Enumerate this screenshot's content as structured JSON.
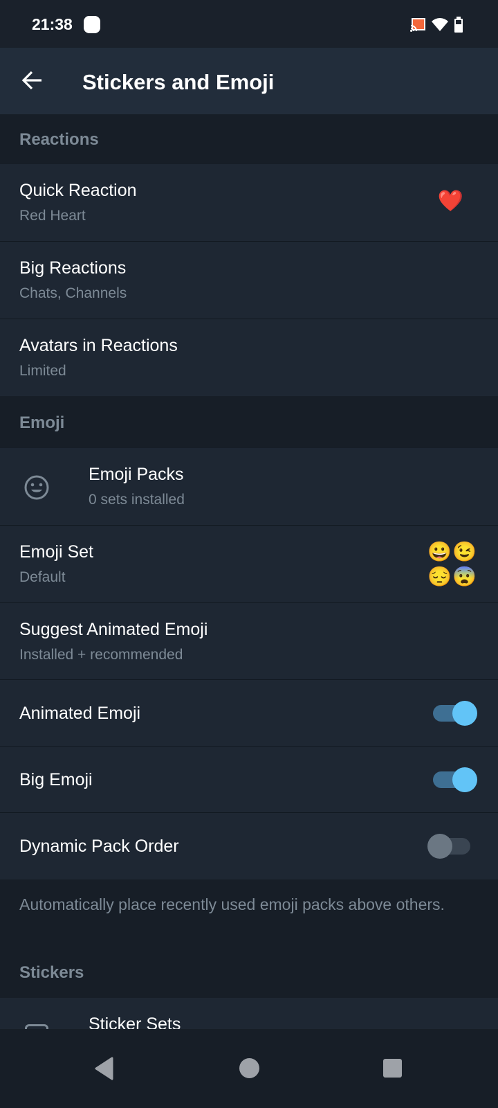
{
  "status_bar": {
    "time": "21:38"
  },
  "header": {
    "title": "Stickers and Emoji"
  },
  "sections": {
    "reactions": "Reactions",
    "emoji": "Emoji",
    "stickers": "Stickers"
  },
  "reactions": {
    "quick": {
      "title": "Quick Reaction",
      "subtitle": "Red Heart",
      "emoji": "❤️"
    },
    "big": {
      "title": "Big Reactions",
      "subtitle": "Chats, Channels"
    },
    "avatars": {
      "title": "Avatars in Reactions",
      "subtitle": "Limited"
    }
  },
  "emoji": {
    "packs": {
      "title": "Emoji Packs",
      "subtitle": "0 sets installed"
    },
    "set": {
      "title": "Emoji Set",
      "subtitle": "Default",
      "preview": [
        "😀",
        "😉",
        "😔",
        "😨"
      ]
    },
    "suggest": {
      "title": "Suggest Animated Emoji",
      "subtitle": "Installed + recommended"
    },
    "animated": {
      "title": "Animated Emoji",
      "on": true
    },
    "big": {
      "title": "Big Emoji",
      "on": true
    },
    "dynamic": {
      "title": "Dynamic Pack Order",
      "on": false
    },
    "info": "Automatically place recently used emoji packs above others."
  },
  "stickers": {
    "sets": {
      "title": "Sticker Sets"
    }
  },
  "colors": {
    "accent": "#62c4f7",
    "toggle_track_on": "#3e6f93",
    "toggle_off_knob": "#6b7783"
  }
}
